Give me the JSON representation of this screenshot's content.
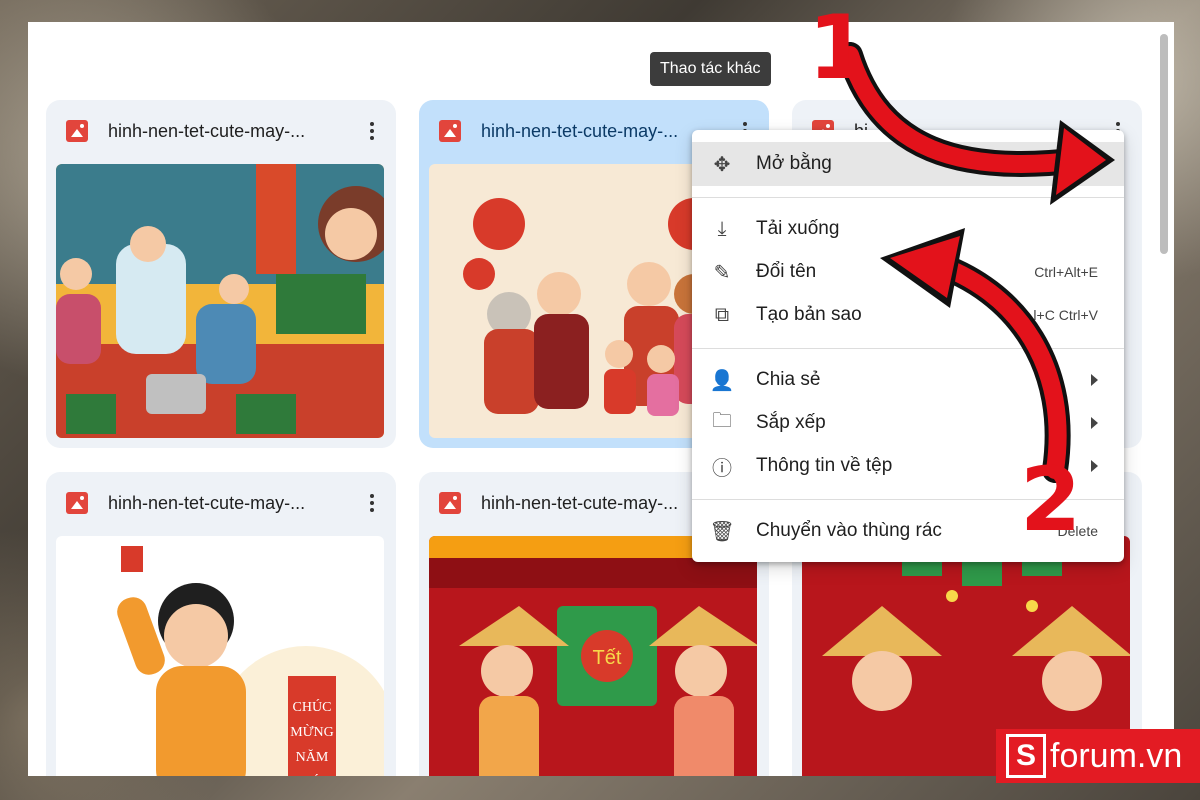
{
  "files": {
    "card1": {
      "title": "hinh-nen-tet-cute-may-..."
    },
    "card2": {
      "title": "hinh-nen-tet-cute-may-..."
    },
    "card3": {
      "title": "hi"
    },
    "card4": {
      "title": "hinh-nen-tet-cute-may-..."
    },
    "card5": {
      "title": "hinh-nen-tet-cute-may-..."
    }
  },
  "thumbnails": {
    "card5_text": "Tết",
    "card4_scroll": "CHÚC MỪNG NĂM MỚI"
  },
  "tooltip": "Thao tác khác",
  "menu": {
    "open_with": "Mở bằng",
    "download": "Tải xuống",
    "rename": "Đổi tên",
    "rename_shortcut": "Ctrl+Alt+E",
    "copy": "Tạo bản sao",
    "copy_shortcut": "l+C Ctrl+V",
    "share": "Chia sẻ",
    "organize": "Sắp xếp",
    "file_info": "Thông tin về tệp",
    "trash": "Chuyển vào thùng rác",
    "trash_shortcut": "Delete"
  },
  "annotations": {
    "step1": "1",
    "step2": "2"
  },
  "brand": {
    "s": "S",
    "name": "forum.vn"
  },
  "colors": {
    "accent": "#e3121b",
    "selected": "#c2e0fb",
    "card": "#eef2f7"
  }
}
